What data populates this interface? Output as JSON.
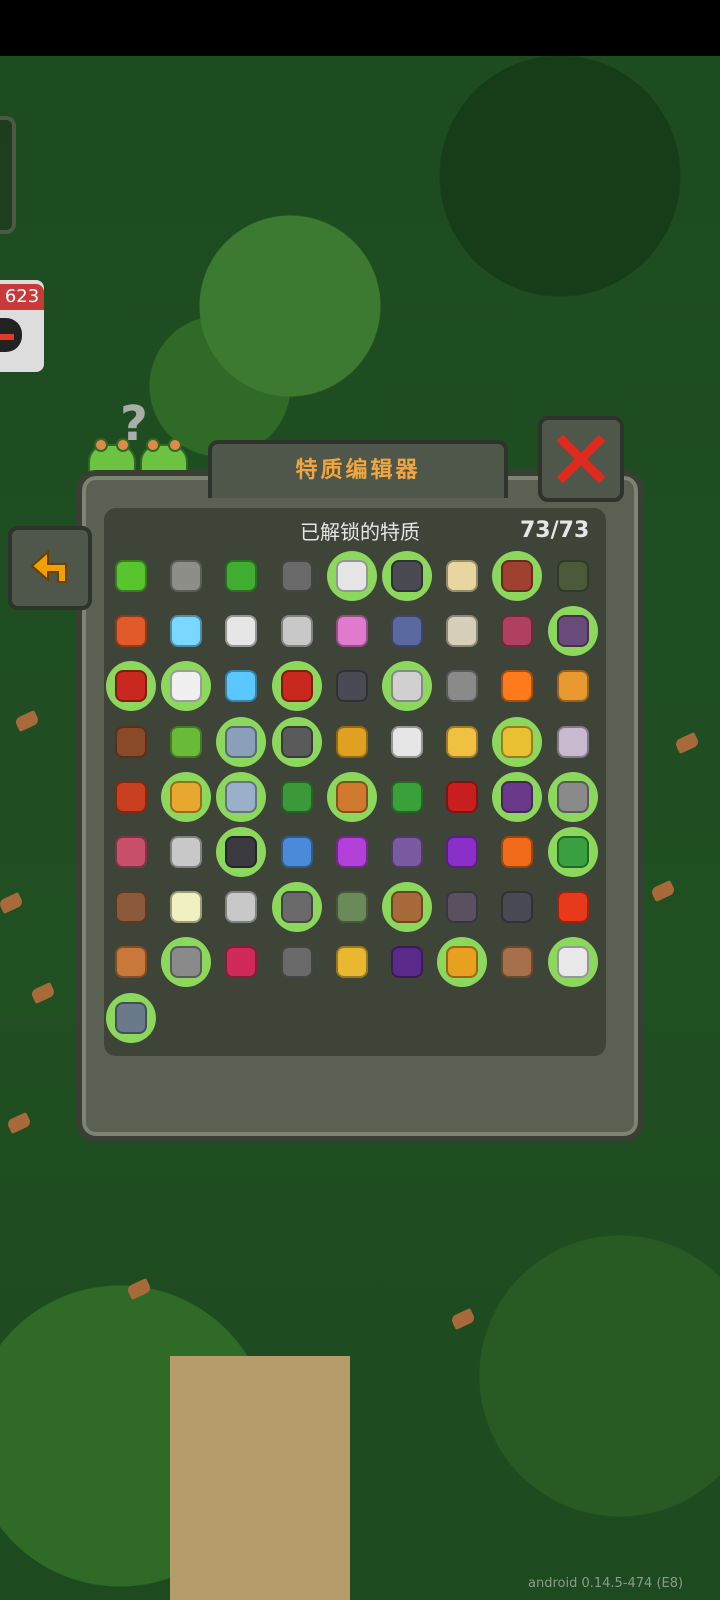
{
  "hud": {
    "notification_count": "623"
  },
  "panel": {
    "title": "特质编辑器",
    "subtitle": "已解锁的特质",
    "counter": "73/73"
  },
  "footer": {
    "version": "android 0.14.5-474 (E8)"
  },
  "traits": [
    {
      "icon": "slime-heart-icon",
      "color": "#58c52e",
      "hl": false
    },
    {
      "icon": "grass-shield-icon",
      "color": "#8d8f86",
      "hl": false
    },
    {
      "icon": "clover-slime-icon",
      "color": "#3fae30",
      "hl": false
    },
    {
      "icon": "speed-blob-icon",
      "color": "#6a6a6a",
      "hl": false
    },
    {
      "icon": "skull-sign-icon",
      "color": "#e6e6e6",
      "hl": true
    },
    {
      "icon": "ghost-dot-icon",
      "color": "#4a4a55",
      "hl": true
    },
    {
      "icon": "blonde-head-icon",
      "color": "#e8d6a0",
      "hl": false
    },
    {
      "icon": "knife-icon",
      "color": "#a04030",
      "hl": true
    },
    {
      "icon": "grenade-icon",
      "color": "#4a5a3a",
      "hl": false
    },
    {
      "icon": "claws-icon",
      "color": "#e05a2a",
      "hl": false
    },
    {
      "icon": "frost-orb-icon",
      "color": "#7ad7ff",
      "hl": false
    },
    {
      "icon": "speech-bubble-icon",
      "color": "#e6e6e6",
      "hl": false
    },
    {
      "icon": "crossed-bones-icon",
      "color": "#c8c8c8",
      "hl": false
    },
    {
      "icon": "pink-bat-icon",
      "color": "#e07acc",
      "hl": false
    },
    {
      "icon": "rocket-fist-icon",
      "color": "#5a6aa0",
      "hl": false
    },
    {
      "icon": "skull-icon",
      "color": "#d8cfb8",
      "hl": false
    },
    {
      "icon": "broken-heart-icon",
      "color": "#b04060",
      "hl": false
    },
    {
      "icon": "witch-hat-icon",
      "color": "#6a4a7a",
      "hl": true
    },
    {
      "icon": "demon-mask-icon",
      "color": "#c8281e",
      "hl": true
    },
    {
      "icon": "eagle-icon",
      "color": "#f0f0f0",
      "hl": true
    },
    {
      "icon": "lightning-icon",
      "color": "#5ac8ff",
      "hl": false
    },
    {
      "icon": "trident-icon",
      "color": "#c8281e",
      "hl": true
    },
    {
      "icon": "dark-figure-icon",
      "color": "#4a4a55",
      "hl": false
    },
    {
      "icon": "rabbit-icon",
      "color": "#d0d0d0",
      "hl": true
    },
    {
      "icon": "gray-blob-icon",
      "color": "#8a8a8a",
      "hl": false
    },
    {
      "icon": "fire-heart-icon",
      "color": "#ff7a1a",
      "hl": false
    },
    {
      "icon": "flame-shield-icon",
      "color": "#e89a30",
      "hl": false
    },
    {
      "icon": "meat-leg-icon",
      "color": "#8a4a2a",
      "hl": false
    },
    {
      "icon": "leaf-bird-icon",
      "color": "#6aba3a",
      "hl": false
    },
    {
      "icon": "storm-shield-icon",
      "color": "#8aa0b8",
      "hl": true
    },
    {
      "icon": "lamp-figure-icon",
      "color": "#5a5a5a",
      "hl": true
    },
    {
      "icon": "flame-demon-icon",
      "color": "#e0a020",
      "hl": false
    },
    {
      "icon": "skull-bubble-icon",
      "color": "#e6e6e6",
      "hl": false
    },
    {
      "icon": "tooth-icon",
      "color": "#f0c040",
      "hl": false
    },
    {
      "icon": "gold-coins-icon",
      "color": "#e8c030",
      "hl": true
    },
    {
      "icon": "sparkle-ghost-icon",
      "color": "#c8b8d0",
      "hl": false
    },
    {
      "icon": "scales-icon",
      "color": "#c84020",
      "hl": false
    },
    {
      "icon": "infinity-icon",
      "color": "#e8a830",
      "hl": true
    },
    {
      "icon": "medic-shield-icon",
      "color": "#9ab0c8",
      "hl": true
    },
    {
      "icon": "green-monster-icon",
      "color": "#3a9a3a",
      "hl": false
    },
    {
      "icon": "witch-face-icon",
      "color": "#d07a30",
      "hl": true
    },
    {
      "icon": "four-leaf-icon",
      "color": "#3aa03a",
      "hl": false
    },
    {
      "icon": "red-eye-icon",
      "color": "#c81e1e",
      "hl": false
    },
    {
      "icon": "dark-wizard-icon",
      "color": "#6a3a8a",
      "hl": true
    },
    {
      "icon": "wand-sparkle-icon",
      "color": "#8a8a8a",
      "hl": true
    },
    {
      "icon": "spotted-mushroom-icon",
      "color": "#c8506a",
      "hl": false
    },
    {
      "icon": "dove-icon",
      "color": "#c8c8c8",
      "hl": false
    },
    {
      "icon": "shadow-head-icon",
      "color": "#3a3a40",
      "hl": true
    },
    {
      "icon": "pinwheel-icon",
      "color": "#4a8ad8",
      "hl": false
    },
    {
      "icon": "purple-flower-icon",
      "color": "#b040d8",
      "hl": false
    },
    {
      "icon": "purple-shield-icon",
      "color": "#7a5aa0",
      "hl": false
    },
    {
      "icon": "purple-blob-icon",
      "color": "#8a30c8",
      "hl": false
    },
    {
      "icon": "campfire-icon",
      "color": "#f06a1a",
      "hl": false
    },
    {
      "icon": "green-feather-icon",
      "color": "#3aa040",
      "hl": true
    },
    {
      "icon": "fox-skull-icon",
      "color": "#8a5a3a",
      "hl": false
    },
    {
      "icon": "sparkles-icon",
      "color": "#f0f0c0",
      "hl": false
    },
    {
      "icon": "glasses-icon",
      "color": "#c8c8c8",
      "hl": false
    },
    {
      "icon": "burning-rock-icon",
      "color": "#6a6a6a",
      "hl": true
    },
    {
      "icon": "turtle-icon",
      "color": "#6a8a5a",
      "hl": false
    },
    {
      "icon": "flex-arm-icon",
      "color": "#a86a3a",
      "hl": true
    },
    {
      "icon": "halo-ghost-icon",
      "color": "#5a5060",
      "hl": false
    },
    {
      "icon": "question-ghost-icon",
      "color": "#4a4a55",
      "hl": false
    },
    {
      "icon": "flaming-heart-icon",
      "color": "#e83a1a",
      "hl": false
    },
    {
      "icon": "bread-beast-icon",
      "color": "#c8783a",
      "hl": false
    },
    {
      "icon": "stone-icon",
      "color": "#8a8a8a",
      "hl": true
    },
    {
      "icon": "raspberry-icon",
      "color": "#d02a5a",
      "hl": false
    },
    {
      "icon": "ghost-card-icon",
      "color": "#6a6a6a",
      "hl": false
    },
    {
      "icon": "shuriken-icon",
      "color": "#e8b830",
      "hl": false
    },
    {
      "icon": "chomper-icon",
      "color": "#5a2a8a",
      "hl": false
    },
    {
      "icon": "medal-icon",
      "color": "#e8a020",
      "hl": true
    },
    {
      "icon": "arm-icon",
      "color": "#a8704a",
      "hl": false
    },
    {
      "icon": "white-feather-icon",
      "color": "#e8e8e8",
      "hl": true
    },
    {
      "icon": "robot-head-icon",
      "color": "#6a7a8a",
      "hl": true
    }
  ],
  "colors": {
    "title_orange": "#f0a640",
    "highlight_green": "#8bd85d",
    "close_red": "#e02a1e",
    "back_arrow": "#f0a000"
  }
}
